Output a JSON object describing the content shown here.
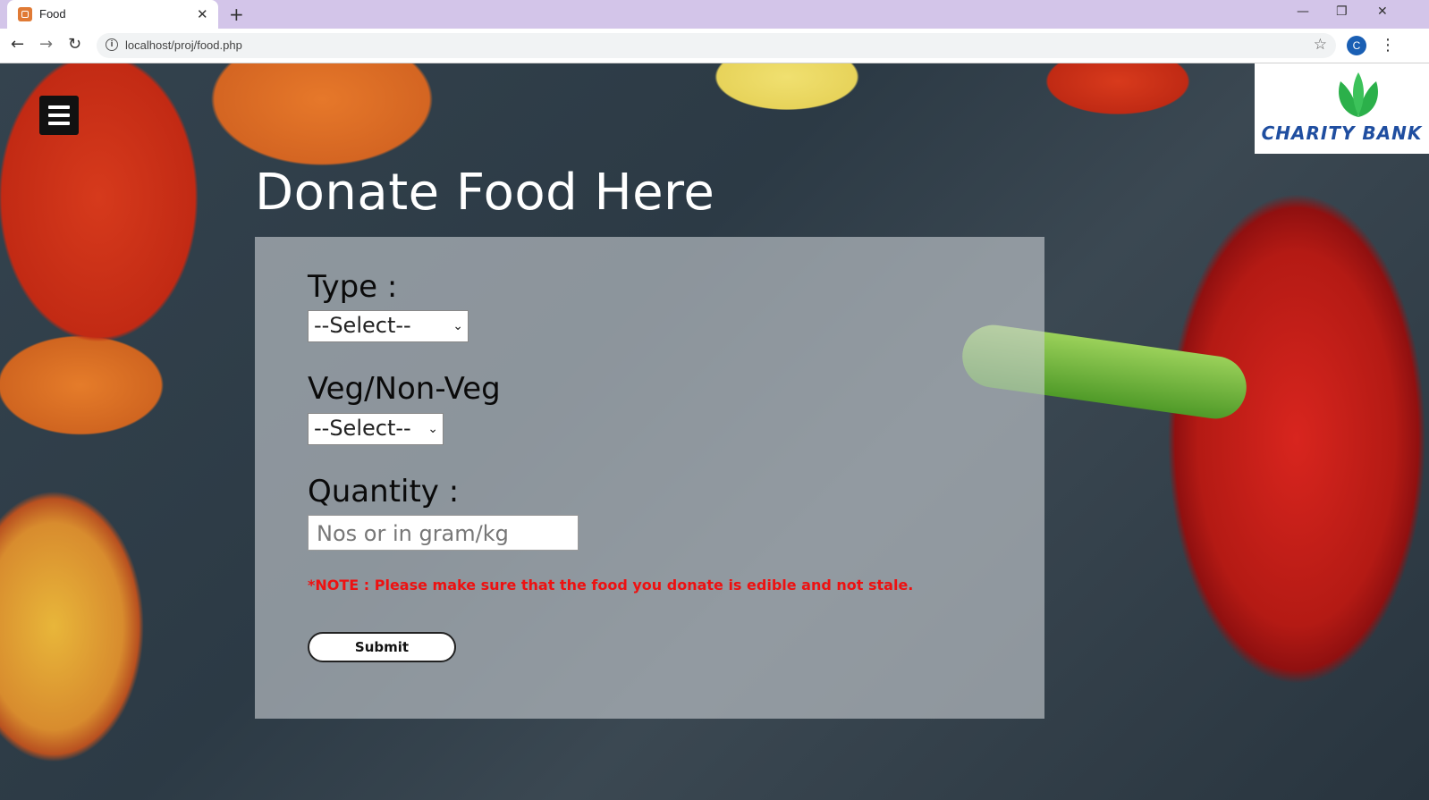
{
  "browser": {
    "tab_title": "Food",
    "tab_close": "✕",
    "new_tab": "+",
    "url": "localhost/proj/food.php",
    "profile_initial": "C",
    "window_controls": {
      "minimize": "—",
      "restore": "❐",
      "close": "✕"
    },
    "nav": {
      "back": "←",
      "forward": "→",
      "reload": "↻"
    },
    "star": "☆",
    "menu": "⋮"
  },
  "header": {
    "logo_text": "CHARITY BANK"
  },
  "form": {
    "heading": "Donate Food Here",
    "type_label": "Type :",
    "type_selected": "--Select--",
    "veg_label": "Veg/Non-Veg",
    "veg_selected": "--Select--",
    "quantity_label": "Quantity :",
    "quantity_placeholder": "Nos or in gram/kg",
    "note": "*NOTE : Please make sure that the food you donate is edible and not stale.",
    "submit_label": "Submit"
  },
  "colors": {
    "note": "#ee1111",
    "logo_text": "#1f4ea0",
    "tab_bar": "#d3c5e9"
  },
  "icons": [
    "favicon-icon",
    "close-icon",
    "plus-icon",
    "back-icon",
    "forward-icon",
    "reload-icon",
    "info-icon",
    "star-icon",
    "profile-icon",
    "kebab-menu-icon",
    "hamburger-menu-icon",
    "leaf-logo-icon",
    "chevron-down-icon"
  ]
}
